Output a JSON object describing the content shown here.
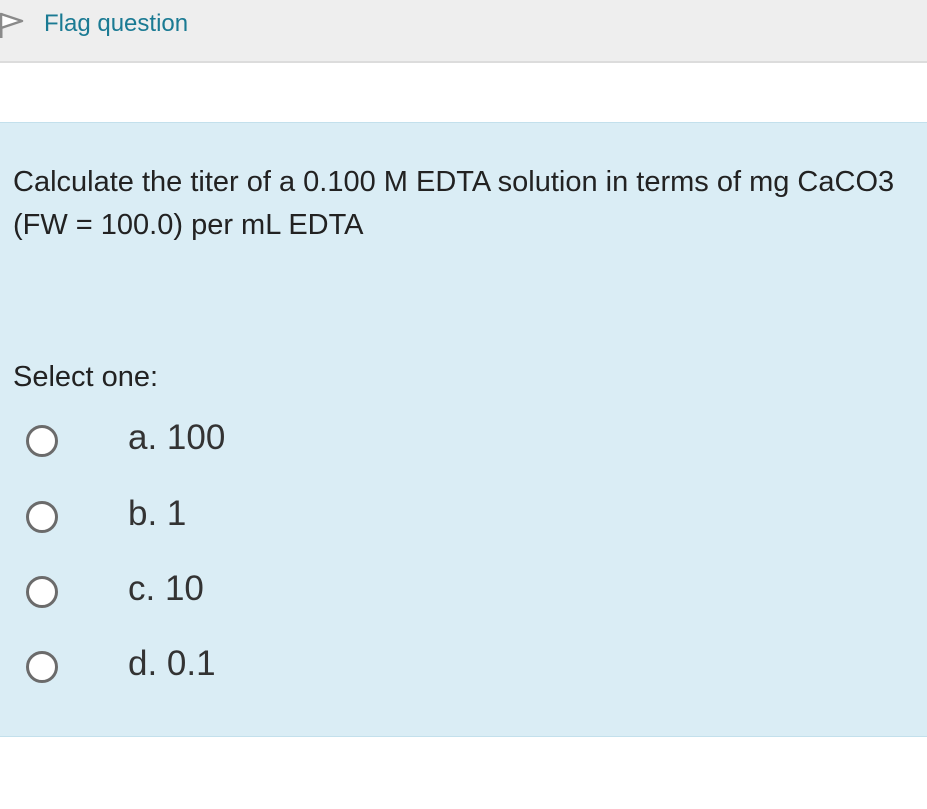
{
  "flag": {
    "label": "Flag question",
    "icon": "flag-icon",
    "color": "#1a7a93"
  },
  "question": {
    "text": "Calculate the titer of a 0.100 M EDTA solution in terms of mg CaCO3 (FW = 100.0) per mL EDTA",
    "background": "#daedf5"
  },
  "answer": {
    "prompt": "Select one:",
    "options": [
      {
        "label": "a. 100",
        "selected": false
      },
      {
        "label": "b. 1",
        "selected": false
      },
      {
        "label": "c. 10",
        "selected": false
      },
      {
        "label": "d. 0.1",
        "selected": false
      }
    ]
  }
}
